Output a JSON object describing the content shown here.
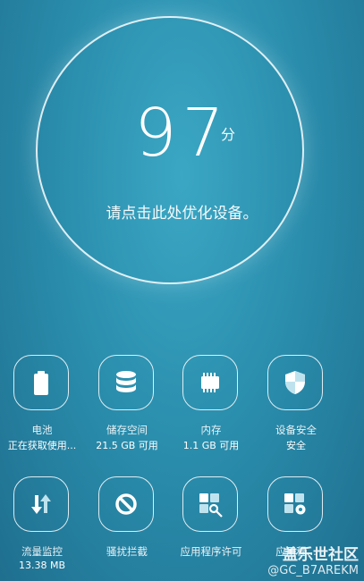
{
  "score": {
    "value": "97",
    "unit": "分",
    "hint": "请点击此处优化设备。"
  },
  "tiles": [
    {
      "name": "battery",
      "label": "电池",
      "value": "正在获取使用..."
    },
    {
      "name": "storage",
      "label": "储存空间",
      "value": "21.5 GB 可用"
    },
    {
      "name": "memory",
      "label": "内存",
      "value": "1.1 GB 可用"
    },
    {
      "name": "security",
      "label": "设备安全",
      "value": "安全"
    },
    {
      "name": "data-usage",
      "label": "流量监控",
      "value": "13.38 MB"
    },
    {
      "name": "block",
      "label": "骚扰拦截",
      "value": ""
    },
    {
      "name": "app-permissions",
      "label": "应用程序许可",
      "value": ""
    },
    {
      "name": "app-settings",
      "label": "应用程...",
      "value": ""
    }
  ],
  "watermark": {
    "title": "盖乐世社区",
    "user": "@GC_B7AREKM"
  }
}
